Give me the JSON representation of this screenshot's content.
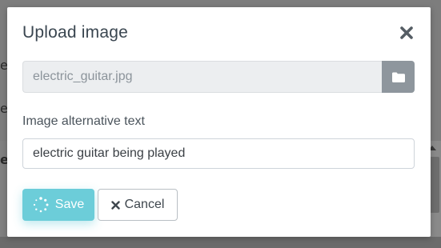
{
  "dialog": {
    "title": "Upload image",
    "close_icon": "close-icon",
    "file_value": "electric_guitar.jpg",
    "browse_icon": "folder-icon",
    "alt_label": "Image alternative text",
    "alt_value": "electric guitar being played",
    "save_label": "Save",
    "save_icon": "spinner-icon",
    "cancel_label": "Cancel",
    "cancel_icon": "close-icon"
  },
  "background": {
    "letters": [
      "e",
      "e",
      "e"
    ]
  },
  "colors": {
    "accent": "#6ccdd9",
    "browse_button": "#8e969d"
  }
}
